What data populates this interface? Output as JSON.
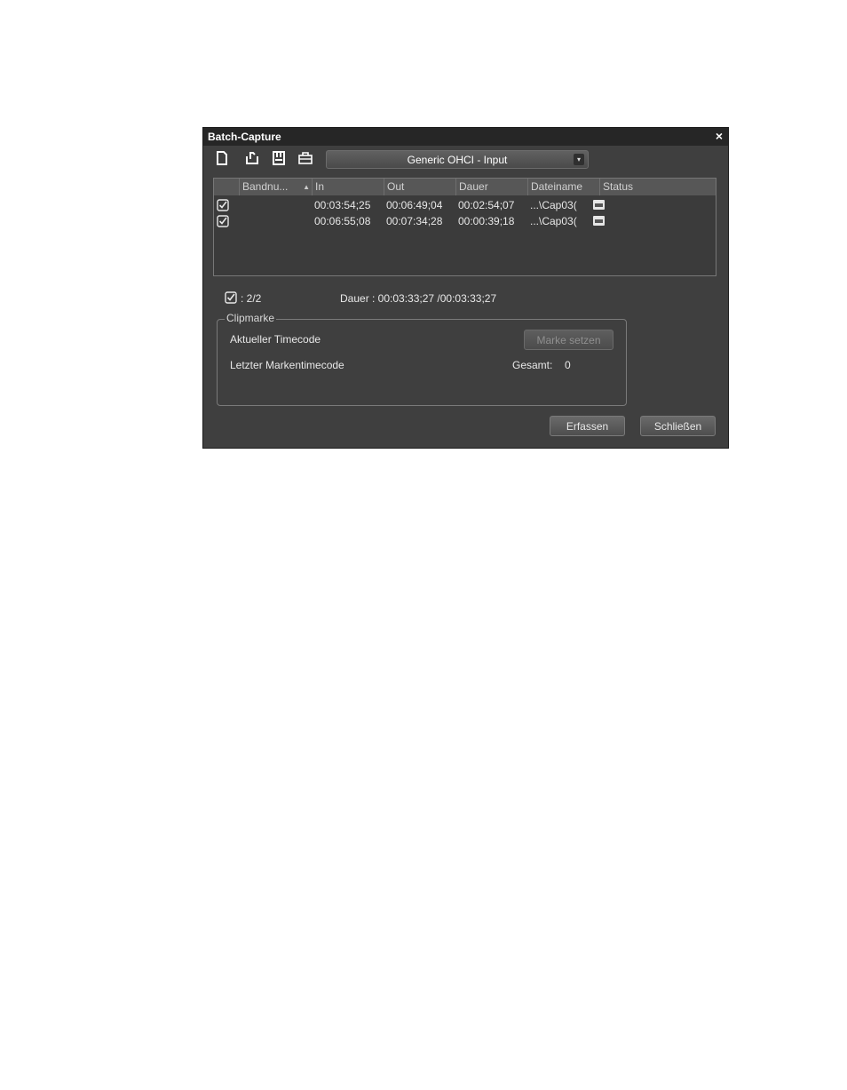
{
  "window": {
    "title": "Batch-Capture",
    "close_label": "×"
  },
  "toolbar": {
    "icons": [
      "new-list-icon",
      "open-list-icon",
      "save-list-icon",
      "export-icon"
    ],
    "device_select": {
      "value": "Generic OHCI - Input",
      "arrow": "▾"
    }
  },
  "table": {
    "columns": [
      {
        "label": ""
      },
      {
        "label": "Bandnu...",
        "sort": "▲"
      },
      {
        "label": "In"
      },
      {
        "label": "Out"
      },
      {
        "label": "Dauer"
      },
      {
        "label": "Dateiname"
      },
      {
        "label": "Status"
      }
    ],
    "rows": [
      {
        "checked": true,
        "tape": "",
        "in": "00:03:54;25",
        "out": "00:06:49;04",
        "duration": "00:02:54;07",
        "filename": "...\\Cap03(",
        "status": ""
      },
      {
        "checked": true,
        "tape": "",
        "in": "00:06:55;08",
        "out": "00:07:34;28",
        "duration": "00:00:39;18",
        "filename": "...\\Cap03(",
        "status": ""
      }
    ]
  },
  "summary": {
    "checked_count": ": 2/2",
    "duration": "Dauer : 00:03:33;27 /00:03:33;27"
  },
  "clipmarke": {
    "legend": "Clipmarke",
    "current_timecode_label": "Aktueller Timecode",
    "set_mark_button": "Marke setzen",
    "last_mark_label": "Letzter Markentimecode",
    "total_label": "Gesamt:",
    "total_value": "0"
  },
  "footer": {
    "capture_button": "Erfassen",
    "close_button": "Schließen"
  }
}
